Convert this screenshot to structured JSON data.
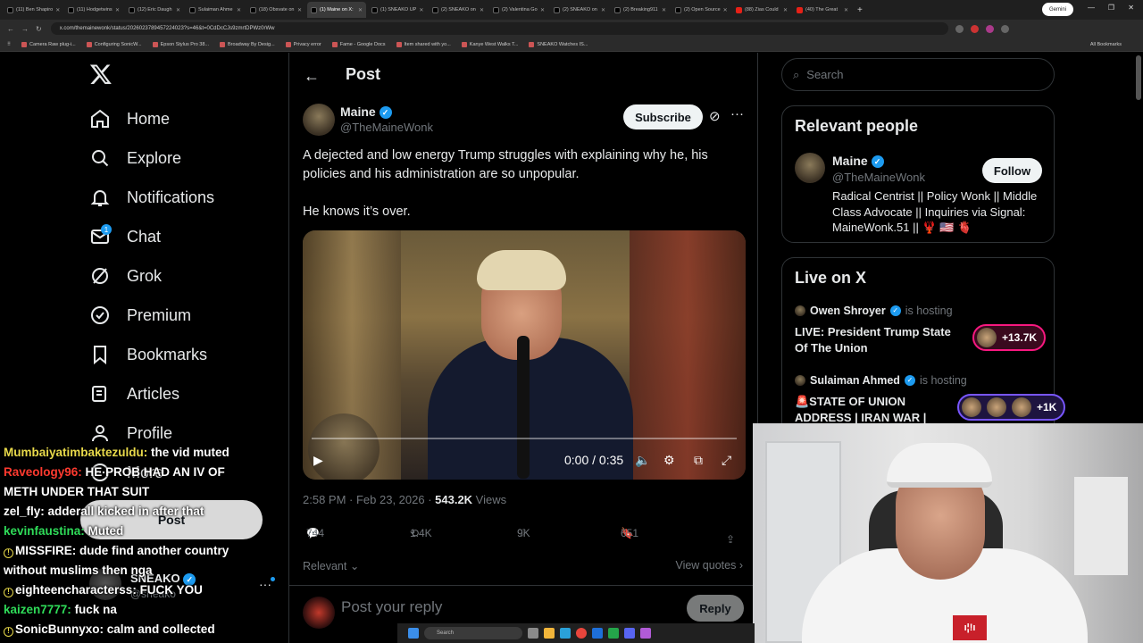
{
  "browser": {
    "tabs": [
      {
        "label": "(11) Ben Shapiro",
        "icon": "x",
        "active": false
      },
      {
        "label": "(11) Hodgetwins",
        "icon": "x",
        "active": false
      },
      {
        "label": "(12) Eric Daugh",
        "icon": "x",
        "active": false
      },
      {
        "label": "Sulaiman Ahme",
        "icon": "x",
        "active": false
      },
      {
        "label": "(18) Obsvate on",
        "icon": "x",
        "active": false
      },
      {
        "label": "(1) Maine on X:",
        "icon": "x",
        "active": true
      },
      {
        "label": "(1) SNEAKO UP",
        "icon": "x",
        "active": false
      },
      {
        "label": "(2) SNEAKO on",
        "icon": "x",
        "active": false
      },
      {
        "label": "(2) Valentina Go",
        "icon": "x",
        "active": false
      },
      {
        "label": "(2) SNEAKO on",
        "icon": "x",
        "active": false
      },
      {
        "label": "(2) Breaking911",
        "icon": "x",
        "active": false
      },
      {
        "label": "(2) Open Source",
        "icon": "x",
        "active": false
      },
      {
        "label": "(88) Zias Could",
        "icon": "yt",
        "active": false
      },
      {
        "label": "(40) The Great",
        "icon": "yt",
        "active": false
      }
    ],
    "gemini_label": "Gemini",
    "url": "x.com/themainewonk/status/2026023789457224023?s=46&t=0CdDcCJs9zmrtDPWz0rWw",
    "bookmarks": [
      "Camera Raw plug-i...",
      "Configuring SonicW...",
      "Epson Stylus Pro 38...",
      "Broadway By Desig...",
      "Privacy error",
      "Fame - Google Docs",
      "Item shared with yo...",
      "Kanye West Walks T...",
      "SNEAKO Watches IS..."
    ],
    "all_bookmarks": "All Bookmarks"
  },
  "nav": {
    "items": [
      {
        "label": "Home",
        "icon": "home-icon"
      },
      {
        "label": "Explore",
        "icon": "search-icon"
      },
      {
        "label": "Notifications",
        "icon": "bell-icon"
      },
      {
        "label": "Chat",
        "icon": "mail-icon",
        "badge": "1"
      },
      {
        "label": "Grok",
        "icon": "grok-icon"
      },
      {
        "label": "Premium",
        "icon": "premium-icon"
      },
      {
        "label": "Bookmarks",
        "icon": "bookmark-icon"
      },
      {
        "label": "Articles",
        "icon": "articles-icon"
      },
      {
        "label": "Profile",
        "icon": "profile-icon"
      },
      {
        "label": "More",
        "icon": "more-icon"
      }
    ],
    "post_button": "Post",
    "account_name": "SNEAKO",
    "account_handle": "@sneako"
  },
  "post": {
    "header": "Post",
    "author_name": "Maine",
    "author_handle": "@TheMaineWonk",
    "subscribe": "Subscribe",
    "text_line1": "A dejected and low energy Trump struggles with explaining why he, his policies and his administration are so unpopular.",
    "text_line2": "He knows it’s over.",
    "video_time": "0:00 / 0:35",
    "timestamp": "2:58 PM · Feb 23, 2026 · ",
    "views_count": "543.2K",
    "views_label": " Views",
    "replies": "744",
    "reposts": "1.4K",
    "likes": "9K",
    "bookmarks": "651",
    "relevant": "Relevant",
    "view_quotes": "View quotes",
    "reply_placeholder": "Post your reply",
    "reply_button": "Reply"
  },
  "sidebar": {
    "search_placeholder": "Search",
    "relevant_title": "Relevant people",
    "person": {
      "name": "Maine",
      "handle": "@TheMaineWonk",
      "follow": "Follow",
      "bio": "Radical Centrist || Policy Wonk || Middle Class Advocate || Inquiries via Signal: MaineWonk.51 || 🦞 🇺🇸 🫀"
    },
    "live_title": "Live on X",
    "live": [
      {
        "host": "Owen Shroyer",
        "suffix": "is hosting",
        "title": "LIVE: President Trump State Of The Union",
        "count": "+13.7K",
        "color": "#f91880"
      },
      {
        "host": "Sulaiman Ahmed",
        "suffix": "is hosting",
        "title": "🚨STATE OF UNION ADDRESS | IRAN WAR |",
        "count": "+1K",
        "color": "#7856ff"
      }
    ]
  },
  "chat": [
    {
      "user": "Mumbaiyatimbaktezuldu:",
      "msg": " the vid muted",
      "color": "yellow",
      "warn": false
    },
    {
      "user": "Raveology96:",
      "msg": " HE PROB HAD AN IV OF",
      "color": "red",
      "warn": false
    },
    {
      "user": "",
      "msg": "METH UNDER THAT SUIT",
      "color": "white",
      "warn": false
    },
    {
      "user": "zel_fly:",
      "msg": " adderall kicked in after that",
      "color": "white",
      "warn": false
    },
    {
      "user": "kevinfaustina:",
      "msg": " Muted",
      "color": "green",
      "warn": false
    },
    {
      "user": "MISSFIRE:",
      "msg": " dude find another country",
      "color": "white",
      "warn": true
    },
    {
      "user": "",
      "msg": "without muslims then nga",
      "color": "white",
      "warn": false
    },
    {
      "user": "eighteencharacterss:",
      "msg": " FUCK YOU",
      "color": "white",
      "warn": true
    },
    {
      "user": "kaizen7777:",
      "msg": " fuck na",
      "color": "green",
      "warn": false
    },
    {
      "user": "SonicBunnyxo:",
      "msg": " calm and collected",
      "color": "white",
      "warn": true
    }
  ],
  "webcam": {
    "patch": "ı¦!ı"
  },
  "taskbar": {
    "search": "Search"
  },
  "colors": {
    "accent": "#1d9bf0",
    "bg": "#000000",
    "border": "#2f3336",
    "muted": "#71767b"
  }
}
